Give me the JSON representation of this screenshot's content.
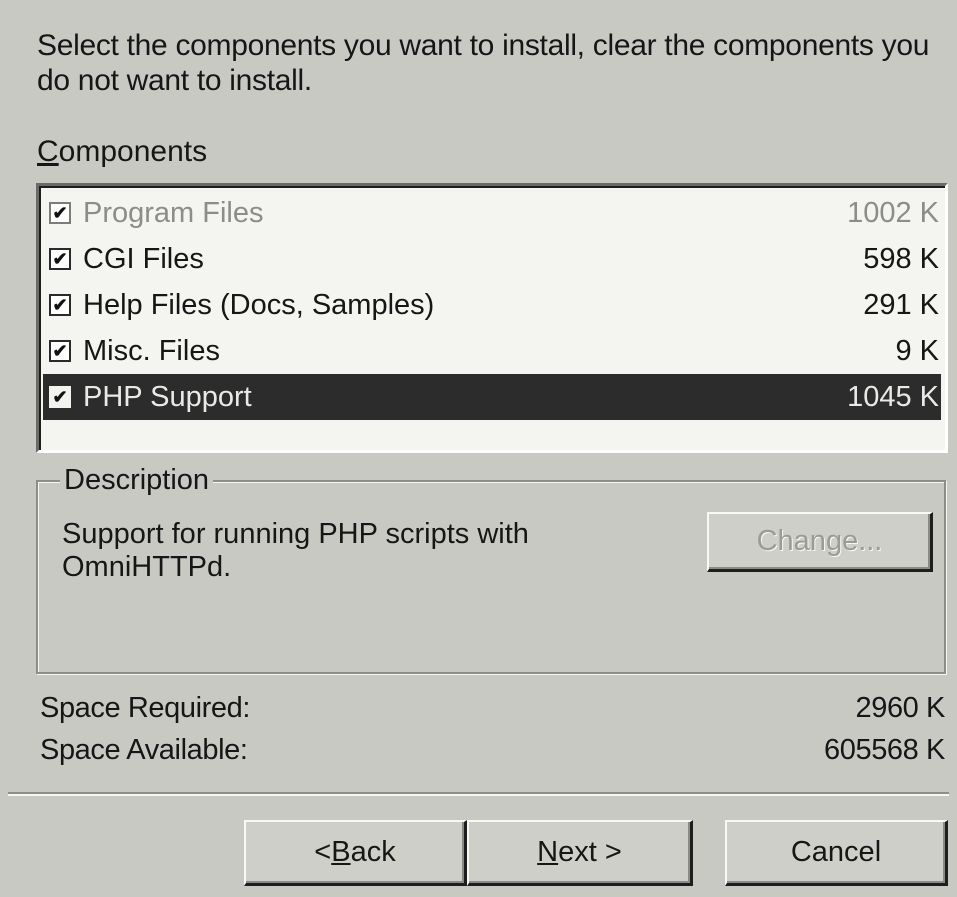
{
  "intro_text": "Select the components you want to install, clear the components you do not want to install.",
  "components": {
    "label_mnemonic": "C",
    "label_rest": "omponents",
    "items": [
      {
        "label": "Program Files",
        "size": "1002 K",
        "checked": true,
        "state": "disabled"
      },
      {
        "label": "CGI Files",
        "size": "598 K",
        "checked": true,
        "state": "normal"
      },
      {
        "label": "Help Files (Docs, Samples)",
        "size": "291 K",
        "checked": true,
        "state": "normal"
      },
      {
        "label": "Misc. Files",
        "size": "9 K",
        "checked": true,
        "state": "normal"
      },
      {
        "label": "PHP Support",
        "size": "1045 K",
        "checked": true,
        "state": "selected"
      }
    ]
  },
  "description": {
    "title": "Description",
    "text_line1": "Support for running PHP scripts with",
    "text_line2": "OmniHTTPd.",
    "change_label": "Change..."
  },
  "space": {
    "required_label": "Space Required:",
    "required_value": "2960 K",
    "available_label": "Space Available:",
    "available_value": "605568 K"
  },
  "buttons": {
    "back_prefix": "< ",
    "back_mnemonic": "B",
    "back_rest": "ack",
    "next_mnemonic": "N",
    "next_rest": "ext >",
    "cancel": "Cancel"
  },
  "colors": {
    "dialog_bg": "#c9c9c4",
    "selection_bg": "#2c2c2c",
    "disabled_text": "#8c8c88"
  }
}
